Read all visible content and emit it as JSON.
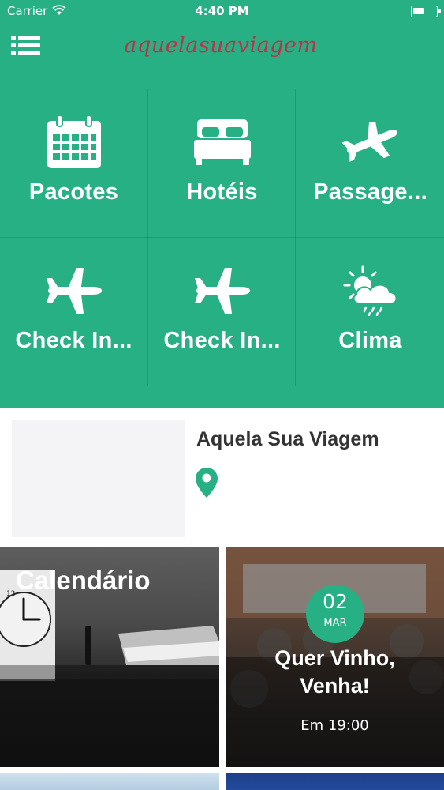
{
  "status_bar": {
    "carrier": "Carrier",
    "time": "4:40 PM"
  },
  "header": {
    "brand": "aquelasuaviagem"
  },
  "tiles": [
    {
      "label": "Pacotes",
      "icon": "calendar-icon"
    },
    {
      "label": "Hotéis",
      "icon": "bed-icon"
    },
    {
      "label": "Passage...",
      "icon": "airplane-icon"
    },
    {
      "label": "Check In...",
      "icon": "airplane-icon"
    },
    {
      "label": "Check In...",
      "icon": "airplane-icon"
    },
    {
      "label": "Clima",
      "icon": "weather-icon"
    }
  ],
  "profile": {
    "name": "Aquela Sua Viagem",
    "icon": "map-pin-icon"
  },
  "cards": {
    "calendar": {
      "title": "Calendário"
    },
    "event": {
      "day": "02",
      "month": "MAR",
      "title_line1": "Quer Vinho,",
      "title_line2": "Venha!",
      "time": "Em 19:00"
    }
  },
  "colors": {
    "primary": "#26b083",
    "brand": "#c1304a",
    "white": "#ffffff"
  }
}
